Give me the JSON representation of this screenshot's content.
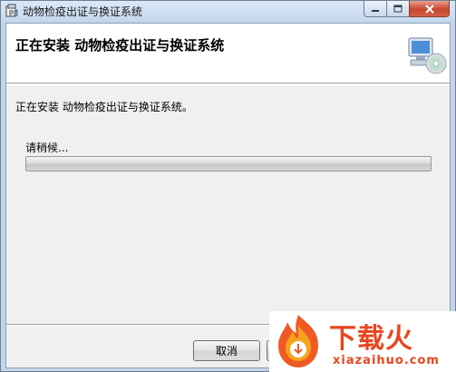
{
  "window": {
    "title": "动物检疫出证与换证系统",
    "app_icon": "installer-app-icon",
    "controls": {
      "minimize_icon": "minimize-icon",
      "maximize_icon": "maximize-icon",
      "close_icon": "close-icon"
    }
  },
  "header": {
    "title": "正在安装  动物检疫出证与换证系统",
    "graphic_icon": "computer-cd-icon"
  },
  "body": {
    "status": "正在安装  动物检疫出证与换证系统。",
    "wait_label": "请稍候...",
    "progress_percent": 0
  },
  "buttons": {
    "cancel_label": "取消",
    "next_label": ""
  },
  "watermark": {
    "brand_text": "下载火",
    "domain_text": "xiazaihuo.com",
    "color": "#e8461f"
  }
}
